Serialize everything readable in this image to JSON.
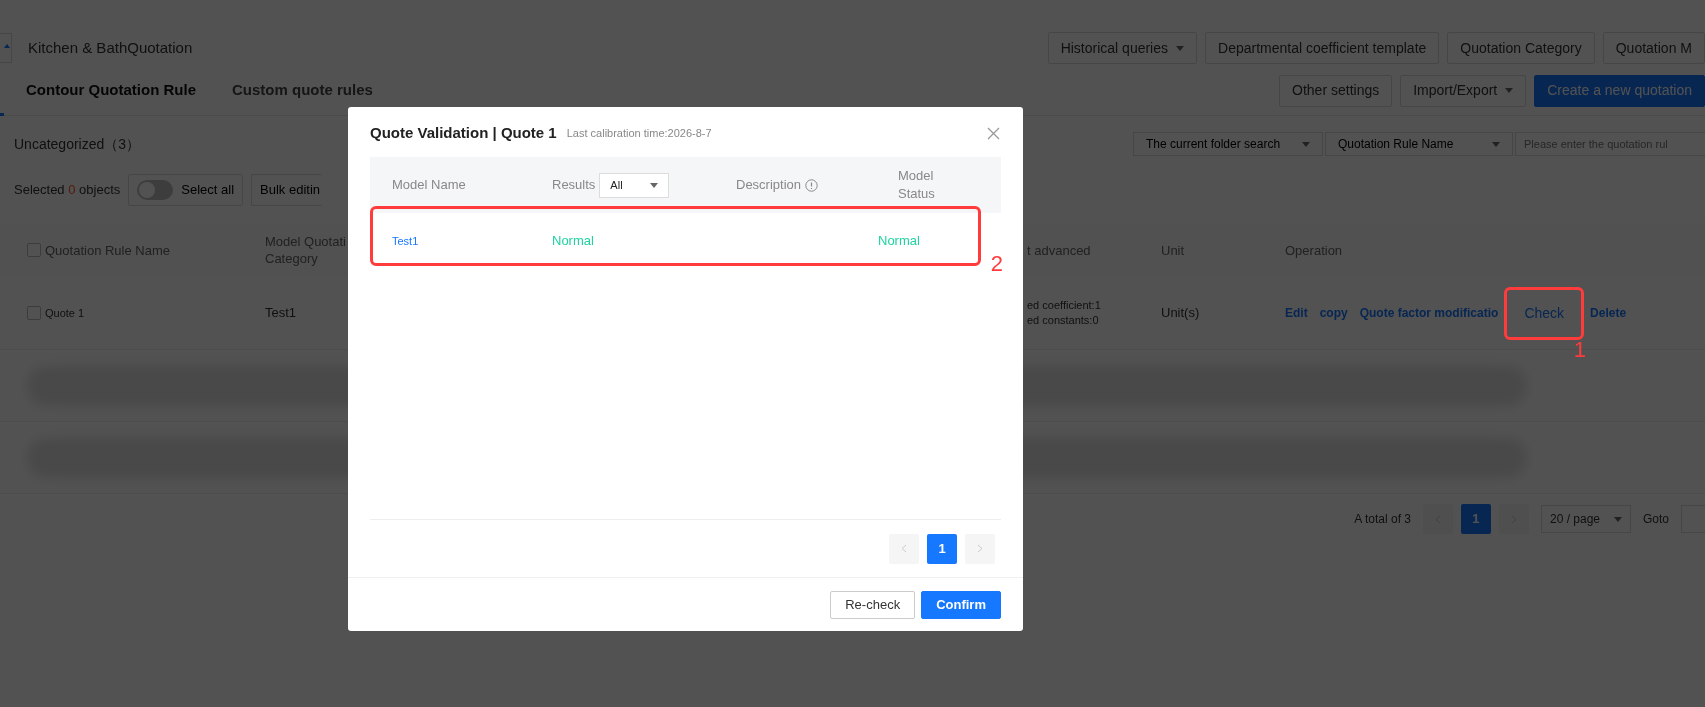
{
  "page": {
    "title": "Kitchen & BathQuotation",
    "header_buttons": [
      {
        "label": "Historical queries",
        "dropdown": true
      },
      {
        "label": "Departmental coefficient template",
        "dropdown": false
      },
      {
        "label": "Quotation Category",
        "dropdown": false
      },
      {
        "label": "Quotation M",
        "dropdown": false
      }
    ],
    "tabs": [
      {
        "label": "Contour Quotation Rule",
        "selected": true
      },
      {
        "label": "Custom quote rules",
        "selected": false
      }
    ],
    "actions": [
      {
        "label": "Other settings",
        "kind": "default",
        "dropdown": false
      },
      {
        "label": "Import/Export",
        "kind": "default",
        "dropdown": true
      },
      {
        "label": "Create a new quotation",
        "kind": "primary",
        "dropdown": false
      }
    ],
    "folder": "Uncategorized（3）",
    "filters": {
      "scope": "The current folder search",
      "field": "Quotation Rule Name",
      "search_placeholder": "Please enter the quotation rul"
    },
    "selection": {
      "prefix": "Selected",
      "count": "0",
      "suffix": "objects"
    },
    "select_all": {
      "label": "Select all",
      "on": false
    },
    "bulk_edit": "Bulk editin",
    "table": {
      "header_checked": false,
      "columns": [
        {
          "lines": [
            "Quotation Rule Name"
          ]
        },
        {
          "lines": [
            "Model Quotati",
            "Category"
          ]
        },
        {
          "lines": [
            "t advanced"
          ]
        },
        {
          "lines": [
            "Unit"
          ]
        },
        {
          "lines": [
            "Operation"
          ]
        }
      ],
      "rows": [
        {
          "checked": false,
          "name": "Quote 1",
          "category": "Test1",
          "coefficients": [
            "ed coefficient:1",
            "ed constants:0"
          ],
          "unit": "Unit(s)",
          "operations": [
            {
              "label": "Edit"
            },
            {
              "label": "copy"
            },
            {
              "label": "Quote factor modificatio"
            },
            {
              "label": "Check",
              "callout": "1"
            },
            {
              "label": "Delete"
            }
          ]
        }
      ]
    },
    "pagination": {
      "total": "A total of 3",
      "pages": [
        {
          "label": "1",
          "selected": true
        }
      ],
      "page_size": "20 / page",
      "goto": "Goto"
    }
  },
  "modal": {
    "title": "Quote Validation | Quote 1",
    "subtitle": "Last calibration time:2026-8-7",
    "columns": {
      "name": "Model Name",
      "results": "Results",
      "results_filter": "All",
      "description": "Description",
      "status_lines": [
        "Model",
        "Status"
      ]
    },
    "rows": [
      {
        "name": "Test1",
        "result": "Normal",
        "status": "Normal",
        "callout": "2"
      }
    ],
    "pages": [
      {
        "label": "1",
        "selected": true
      }
    ],
    "buttons": [
      {
        "label": "Re-check",
        "kind": "default"
      },
      {
        "label": "Confirm",
        "kind": "primary"
      }
    ]
  }
}
